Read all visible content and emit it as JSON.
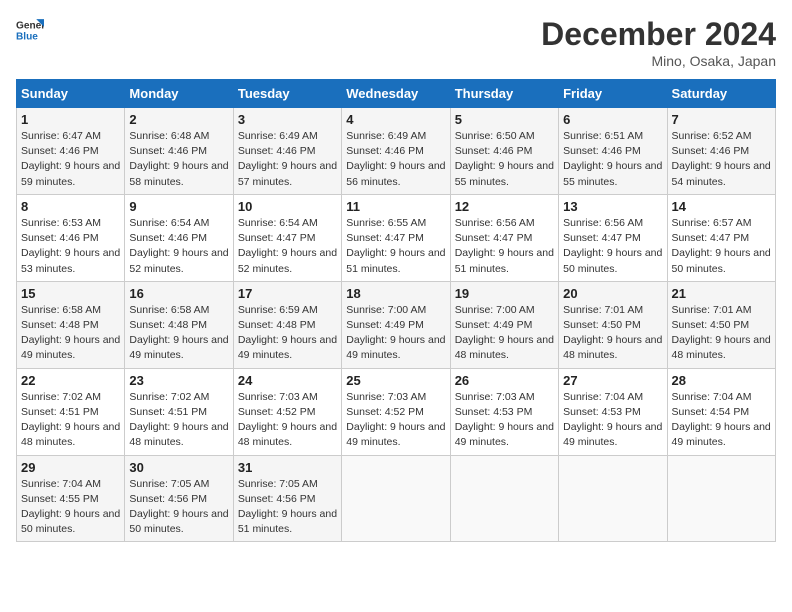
{
  "header": {
    "logo_line1": "General",
    "logo_line2": "Blue",
    "month_title": "December 2024",
    "subtitle": "Mino, Osaka, Japan"
  },
  "weekdays": [
    "Sunday",
    "Monday",
    "Tuesday",
    "Wednesday",
    "Thursday",
    "Friday",
    "Saturday"
  ],
  "weeks": [
    [
      {
        "day": "1",
        "sunrise": "6:47 AM",
        "sunset": "4:46 PM",
        "daylight": "9 hours and 59 minutes."
      },
      {
        "day": "2",
        "sunrise": "6:48 AM",
        "sunset": "4:46 PM",
        "daylight": "9 hours and 58 minutes."
      },
      {
        "day": "3",
        "sunrise": "6:49 AM",
        "sunset": "4:46 PM",
        "daylight": "9 hours and 57 minutes."
      },
      {
        "day": "4",
        "sunrise": "6:49 AM",
        "sunset": "4:46 PM",
        "daylight": "9 hours and 56 minutes."
      },
      {
        "day": "5",
        "sunrise": "6:50 AM",
        "sunset": "4:46 PM",
        "daylight": "9 hours and 55 minutes."
      },
      {
        "day": "6",
        "sunrise": "6:51 AM",
        "sunset": "4:46 PM",
        "daylight": "9 hours and 55 minutes."
      },
      {
        "day": "7",
        "sunrise": "6:52 AM",
        "sunset": "4:46 PM",
        "daylight": "9 hours and 54 minutes."
      }
    ],
    [
      {
        "day": "8",
        "sunrise": "6:53 AM",
        "sunset": "4:46 PM",
        "daylight": "9 hours and 53 minutes."
      },
      {
        "day": "9",
        "sunrise": "6:54 AM",
        "sunset": "4:46 PM",
        "daylight": "9 hours and 52 minutes."
      },
      {
        "day": "10",
        "sunrise": "6:54 AM",
        "sunset": "4:47 PM",
        "daylight": "9 hours and 52 minutes."
      },
      {
        "day": "11",
        "sunrise": "6:55 AM",
        "sunset": "4:47 PM",
        "daylight": "9 hours and 51 minutes."
      },
      {
        "day": "12",
        "sunrise": "6:56 AM",
        "sunset": "4:47 PM",
        "daylight": "9 hours and 51 minutes."
      },
      {
        "day": "13",
        "sunrise": "6:56 AM",
        "sunset": "4:47 PM",
        "daylight": "9 hours and 50 minutes."
      },
      {
        "day": "14",
        "sunrise": "6:57 AM",
        "sunset": "4:47 PM",
        "daylight": "9 hours and 50 minutes."
      }
    ],
    [
      {
        "day": "15",
        "sunrise": "6:58 AM",
        "sunset": "4:48 PM",
        "daylight": "9 hours and 49 minutes."
      },
      {
        "day": "16",
        "sunrise": "6:58 AM",
        "sunset": "4:48 PM",
        "daylight": "9 hours and 49 minutes."
      },
      {
        "day": "17",
        "sunrise": "6:59 AM",
        "sunset": "4:48 PM",
        "daylight": "9 hours and 49 minutes."
      },
      {
        "day": "18",
        "sunrise": "7:00 AM",
        "sunset": "4:49 PM",
        "daylight": "9 hours and 49 minutes."
      },
      {
        "day": "19",
        "sunrise": "7:00 AM",
        "sunset": "4:49 PM",
        "daylight": "9 hours and 48 minutes."
      },
      {
        "day": "20",
        "sunrise": "7:01 AM",
        "sunset": "4:50 PM",
        "daylight": "9 hours and 48 minutes."
      },
      {
        "day": "21",
        "sunrise": "7:01 AM",
        "sunset": "4:50 PM",
        "daylight": "9 hours and 48 minutes."
      }
    ],
    [
      {
        "day": "22",
        "sunrise": "7:02 AM",
        "sunset": "4:51 PM",
        "daylight": "9 hours and 48 minutes."
      },
      {
        "day": "23",
        "sunrise": "7:02 AM",
        "sunset": "4:51 PM",
        "daylight": "9 hours and 48 minutes."
      },
      {
        "day": "24",
        "sunrise": "7:03 AM",
        "sunset": "4:52 PM",
        "daylight": "9 hours and 48 minutes."
      },
      {
        "day": "25",
        "sunrise": "7:03 AM",
        "sunset": "4:52 PM",
        "daylight": "9 hours and 49 minutes."
      },
      {
        "day": "26",
        "sunrise": "7:03 AM",
        "sunset": "4:53 PM",
        "daylight": "9 hours and 49 minutes."
      },
      {
        "day": "27",
        "sunrise": "7:04 AM",
        "sunset": "4:53 PM",
        "daylight": "9 hours and 49 minutes."
      },
      {
        "day": "28",
        "sunrise": "7:04 AM",
        "sunset": "4:54 PM",
        "daylight": "9 hours and 49 minutes."
      }
    ],
    [
      {
        "day": "29",
        "sunrise": "7:04 AM",
        "sunset": "4:55 PM",
        "daylight": "9 hours and 50 minutes."
      },
      {
        "day": "30",
        "sunrise": "7:05 AM",
        "sunset": "4:56 PM",
        "daylight": "9 hours and 50 minutes."
      },
      {
        "day": "31",
        "sunrise": "7:05 AM",
        "sunset": "4:56 PM",
        "daylight": "9 hours and 51 minutes."
      },
      null,
      null,
      null,
      null
    ]
  ]
}
